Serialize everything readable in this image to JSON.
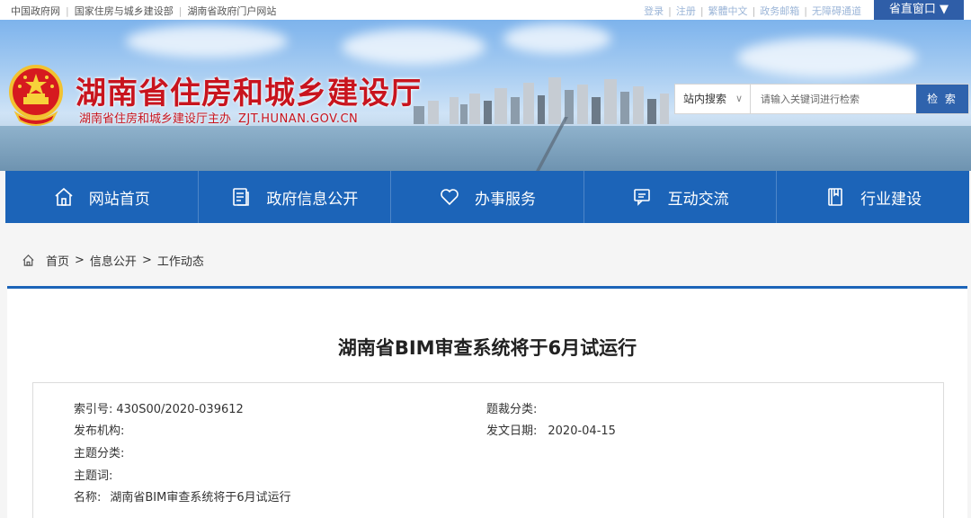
{
  "top_bar": {
    "left_links": [
      "中国政府网",
      "国家住房与城乡建设部",
      "湖南省政府门户网站"
    ],
    "right_links": [
      "登录",
      "注册",
      "繁體中文",
      "政务邮箱",
      "无障碍通道"
    ],
    "region_button": "省直窗口 ▼"
  },
  "header": {
    "site_title": "湖南省住房和城乡建设厅",
    "site_subtitle": "湖南省住房和城乡建设厅主办",
    "site_url": "ZJT.HUNAN.GOV.CN"
  },
  "search": {
    "scope": "站内搜索",
    "placeholder": "请输入关键词进行检索",
    "button": "检 索"
  },
  "nav": {
    "items": [
      {
        "label": "网站首页",
        "icon": "home-icon"
      },
      {
        "label": "政府信息公开",
        "icon": "document-icon"
      },
      {
        "label": "办事服务",
        "icon": "heart-icon"
      },
      {
        "label": "互动交流",
        "icon": "chat-icon"
      },
      {
        "label": "行业建设",
        "icon": "book-icon"
      }
    ]
  },
  "breadcrumb": [
    "首页",
    "信息公开",
    "工作动态"
  ],
  "article": {
    "title": "湖南省BIM审查系统将于6月试运行",
    "meta": {
      "index_label": "索引号:",
      "index_value": "430S00/2020-039612",
      "subject_cat_label": "题裁分类:",
      "subject_cat_value": "",
      "publisher_label": "发布机构:",
      "publisher_value": "",
      "date_label": "发文日期:",
      "date_value": "2020-04-15",
      "topic_label": "主题分类:",
      "topic_value": "",
      "keywords_label": "主题词:",
      "keywords_value": "",
      "name_label": "名称:",
      "name_value": "湖南省BIM审查系统将于6月试运行"
    }
  },
  "colors": {
    "brand_blue": "#1c64b8",
    "title_red": "#c8141e"
  }
}
